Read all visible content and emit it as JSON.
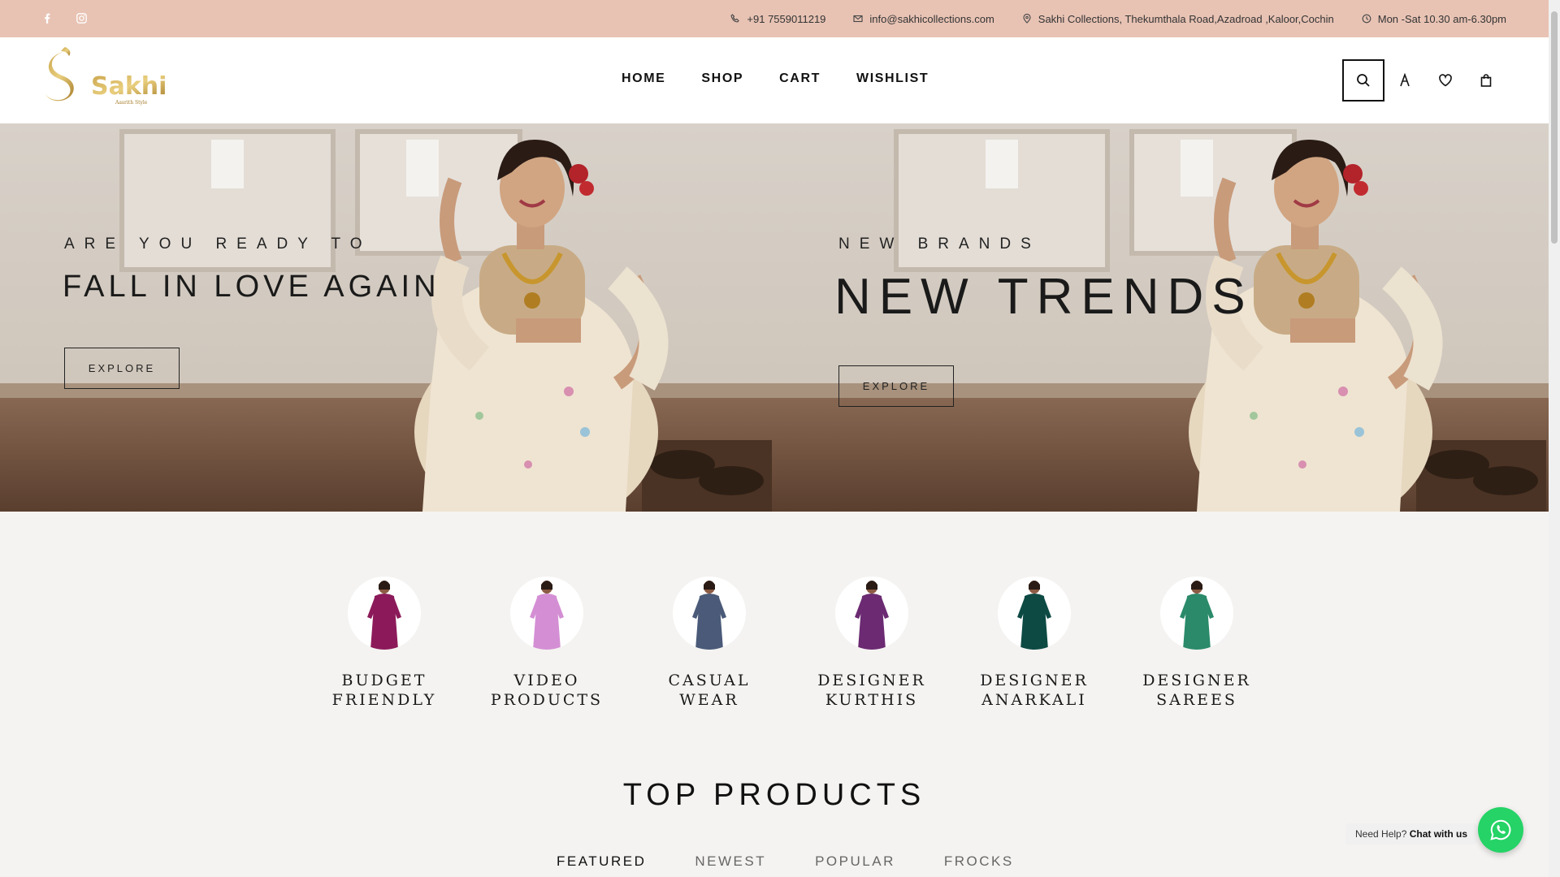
{
  "topbar": {
    "social": [
      "facebook-icon",
      "instagram-icon"
    ],
    "phone": "+91 7559011219",
    "email": "info@sakhicollections.com",
    "address": "Sakhi Collections, Thekumthala Road,Azadroad ,Kaloor,Cochin",
    "hours": "Mon -Sat 10.30 am-6.30pm",
    "bg_color": "#e8c3b4"
  },
  "header": {
    "logo_text": "Sakhi",
    "logo_tagline": "Aasrith Style",
    "nav": [
      "HOME",
      "SHOP",
      "CART",
      "WISHLIST"
    ],
    "icons": [
      "search-icon",
      "user-icon",
      "heart-icon",
      "bag-icon"
    ]
  },
  "banners": [
    {
      "subtitle": "ARE YOU READY TO",
      "title": "FALL IN LOVE AGAIN",
      "button": "EXPLORE"
    },
    {
      "subtitle": "NEW BRANDS",
      "title": "NEW TRENDS",
      "button": "EXPLORE"
    }
  ],
  "categories": [
    {
      "label": "BUDGET\nFRIENDLY",
      "dress_color": "#8c1a5a"
    },
    {
      "label": "VIDEO\nPRODUCTS",
      "dress_color": "#d48fd4"
    },
    {
      "label": "CASUAL\nWEAR",
      "dress_color": "#4a5a78"
    },
    {
      "label": "DESIGNER\nKURTHIS",
      "dress_color": "#6b2a72"
    },
    {
      "label": "DESIGNER\nANARKALI",
      "dress_color": "#0d4a44"
    },
    {
      "label": "DESIGNER\nSAREES",
      "dress_color": "#2a8a6a"
    }
  ],
  "top_products": {
    "title": "TOP PRODUCTS",
    "tabs": [
      "FEATURED",
      "NEWEST",
      "POPULAR",
      "FROCKS"
    ],
    "active_tab": "FEATURED"
  },
  "whatsapp": {
    "prefix": "Need Help?",
    "cta": "Chat with us",
    "color": "#25d366"
  }
}
